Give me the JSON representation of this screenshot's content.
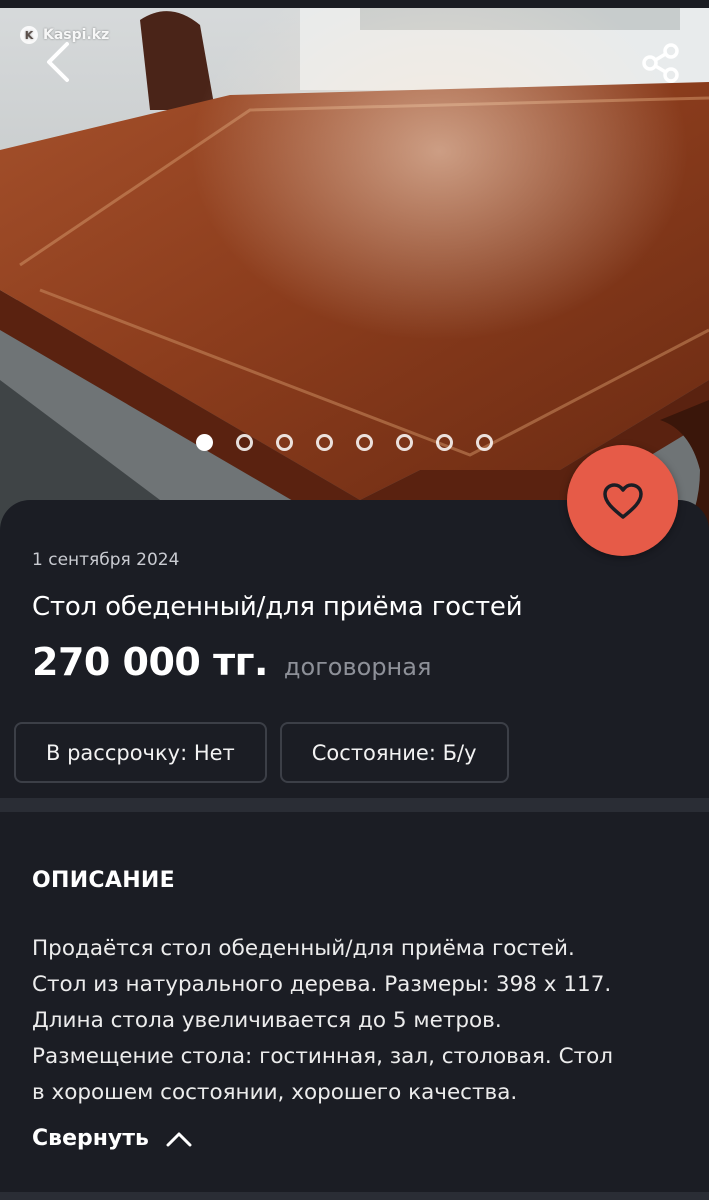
{
  "gallery": {
    "watermark": "Kaspi.kz",
    "photo_count": 8,
    "active_index": 0,
    "photo_description_icon": "table-photo"
  },
  "toolbar": {
    "back_icon": "chevron-left-icon",
    "share_icon": "share-icon",
    "favorite_icon": "heart-icon"
  },
  "listing": {
    "date": "1 сентября 2024",
    "title": "Стол обеденный/для приёма гостей",
    "price": "270 000 тг.",
    "price_note": "договорная",
    "chips": [
      {
        "label": "В рассрочку: Нет"
      },
      {
        "label": "Состояние: Б/у"
      }
    ]
  },
  "description": {
    "heading": "ОПИСАНИЕ",
    "lines": [
      "Продаётся стол обеденный/для приёма гостей.",
      "Стол из натурального дерева. Размеры: 398 х 117.",
      "Длина стола увеличивается до 5 метров.",
      "Размещение стола: гостинная, зал, столовая. Стол",
      "в хорошем состоянии, хорошего качества."
    ],
    "collapse_label": "Свернуть"
  },
  "colors": {
    "background": "#1b1d24",
    "accent": "#e65b48",
    "muted_text": "#8d9098",
    "chip_border": "#3c3f47"
  }
}
